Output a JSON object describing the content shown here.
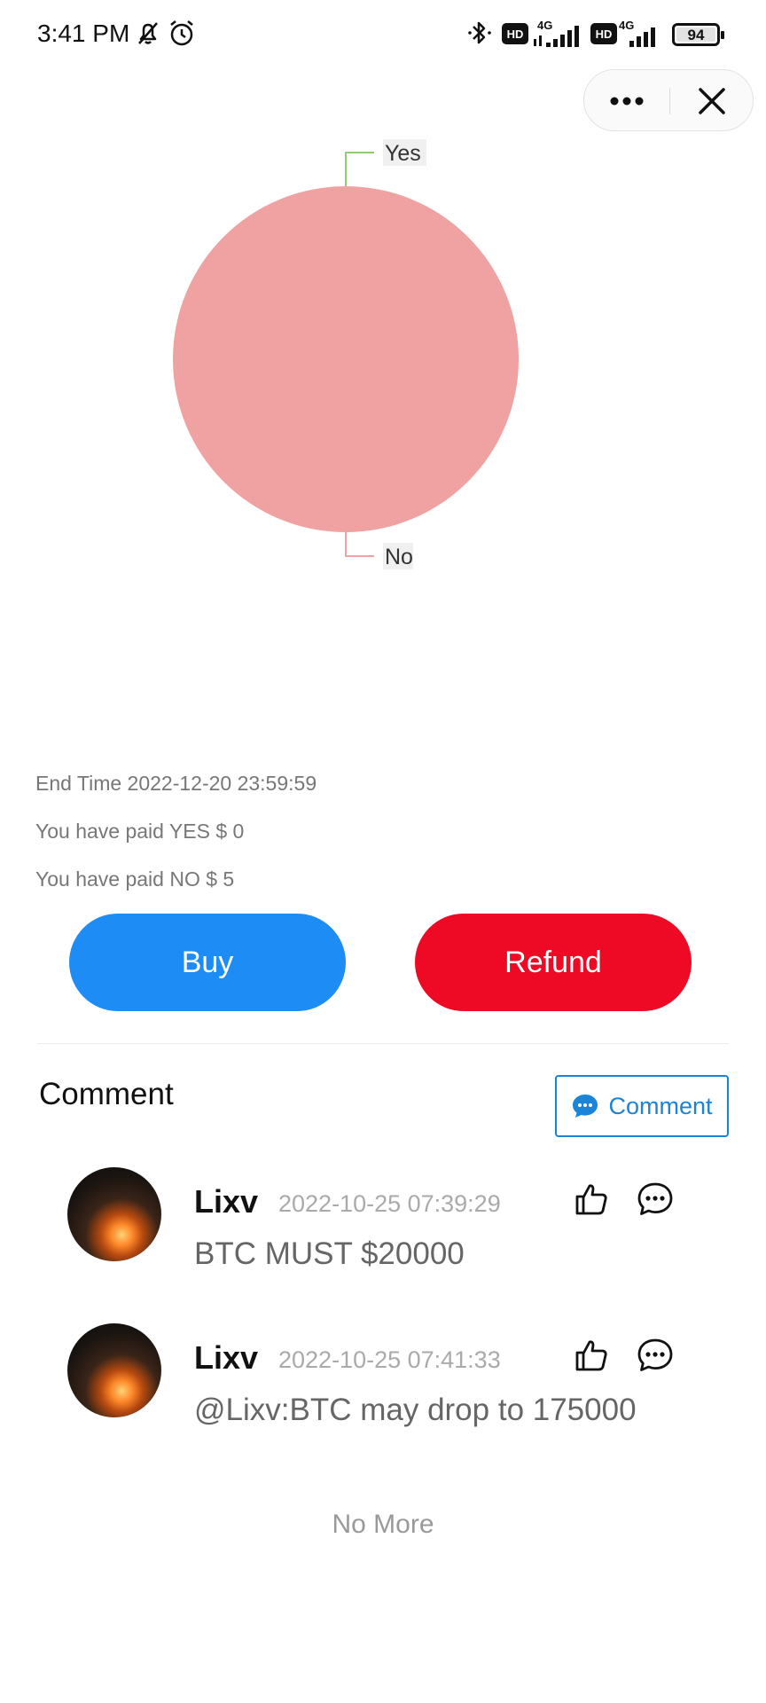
{
  "status_bar": {
    "time": "3:41 PM",
    "icons": [
      "bell-off-icon",
      "alarm-icon",
      "bluetooth-icon",
      "hd-icon",
      "signal-4g-icon",
      "hd-icon",
      "signal-4g-icon"
    ],
    "hd_label": "HD",
    "network_label": "4G",
    "battery": "94"
  },
  "capsule": {
    "more_icon": "more-dots-icon",
    "close_icon": "close-icon"
  },
  "chart_data": {
    "type": "pie",
    "labels": [
      "Yes",
      "No"
    ],
    "values": [
      0,
      5
    ],
    "colors": [
      "#91cc75",
      "#f0a1a1"
    ],
    "legend": false
  },
  "info": {
    "end_time": "End Time 2022-12-20 23:59:59",
    "paid_yes": "You have paid YES $ 0",
    "paid_no": "You have paid NO $ 5"
  },
  "actions": {
    "buy": "Buy",
    "refund": "Refund"
  },
  "comments_section": {
    "title": "Comment",
    "button_label": "Comment",
    "items": [
      {
        "user": "Lixv",
        "time": "2022-10-25 07:39:29",
        "text": "BTC MUST $20000"
      },
      {
        "user": "Lixv",
        "time": "2022-10-25 07:41:33",
        "text": "@Lixv:BTC may drop to 175000"
      }
    ],
    "end_text": "No More"
  },
  "colors": {
    "accent_blue": "#1e8cf5",
    "refund_red": "#ee0a24",
    "link_blue": "#1a84d8"
  }
}
